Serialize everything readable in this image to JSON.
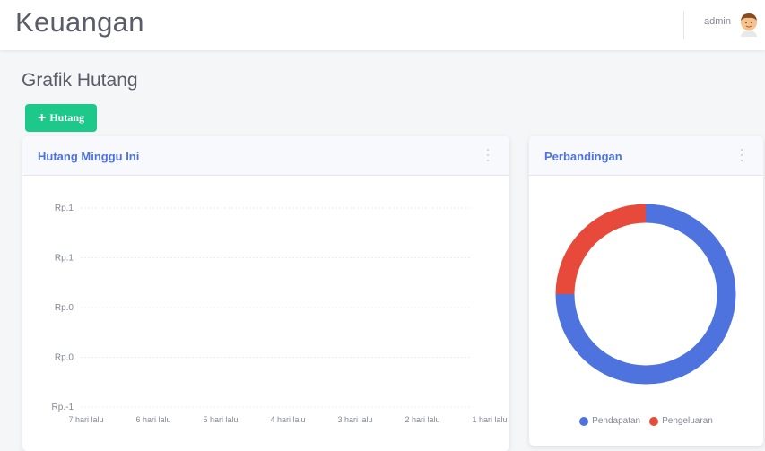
{
  "header": {
    "title": "Keuangan",
    "user": "admin"
  },
  "page": {
    "title": "Grafik Hutang",
    "add_button": "Hutang"
  },
  "line_card": {
    "title": "Hutang Minggu Ini",
    "chart_data": {
      "type": "line",
      "categories": [
        "7 hari lalu",
        "6 hari lalu",
        "5 hari lalu",
        "4 hari lalu",
        "3 hari lalu",
        "2 hari lalu",
        "1 hari lalu"
      ],
      "y_tick_labels": [
        "Rp.1",
        "Rp.1",
        "Rp.0",
        "Rp.0",
        "Rp.-1"
      ],
      "series": [],
      "grid": true
    }
  },
  "pie_card": {
    "title": "Perbandingan",
    "chart_data": {
      "type": "pie",
      "donut": true,
      "labels": [
        "Pendapatan",
        "Pengeluaran"
      ],
      "values": [
        75,
        25
      ],
      "colors": [
        "#4e73df",
        "#e74a3b"
      ],
      "legend": "bottom"
    }
  }
}
